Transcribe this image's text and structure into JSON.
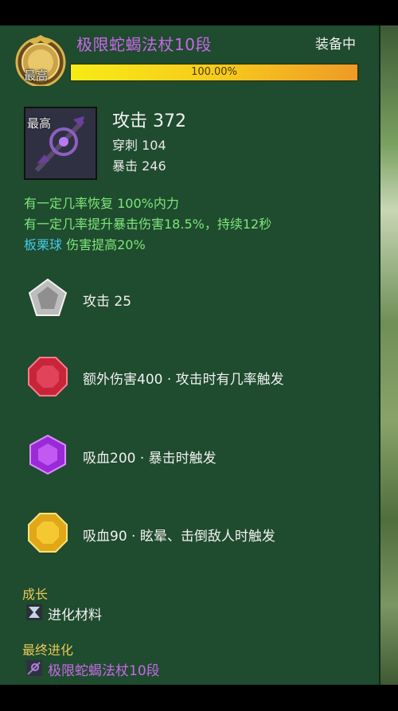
{
  "item": {
    "name": "极限蛇蝎法杖10段",
    "equip_status": "装备中",
    "grade_badge": "最高",
    "progress_text": "100.00%",
    "progress_fraction": 1.0
  },
  "weapon": {
    "grade": "最高",
    "main_stat": "攻击 372",
    "sub_stats": [
      "穿刺 104",
      "暴击 246"
    ]
  },
  "effects": {
    "line1": "有一定几率恢复 100%内力",
    "line2": "有一定几率提升暴击伤害18.5%，持续12秒",
    "line3_name": "板栗球",
    "line3_text": " 伤害提高20%"
  },
  "gems": [
    {
      "icon": "silver-pentagon-gem-icon",
      "text": "攻击 25"
    },
    {
      "icon": "red-octagon-gem-icon",
      "text": "额外伤害400 · 攻击时有几率触发"
    },
    {
      "icon": "purple-hexagon-gem-icon",
      "text": "吸血200 · 暴击时触发"
    },
    {
      "icon": "gold-octagon-gem-icon",
      "text": "吸血90 · 眩晕、击倒敌人时触发"
    }
  ],
  "growth": {
    "title": "成长",
    "item": "进化材料"
  },
  "final": {
    "title": "最终进化",
    "item": "极限蛇蝎法杖10段"
  },
  "colors": {
    "panel_bg": "#1f4b2e",
    "item_name": "#c869e8",
    "effect_green": "#7de67a",
    "effect_cyan": "#45c9e8",
    "section_gold": "#e6c85a"
  }
}
